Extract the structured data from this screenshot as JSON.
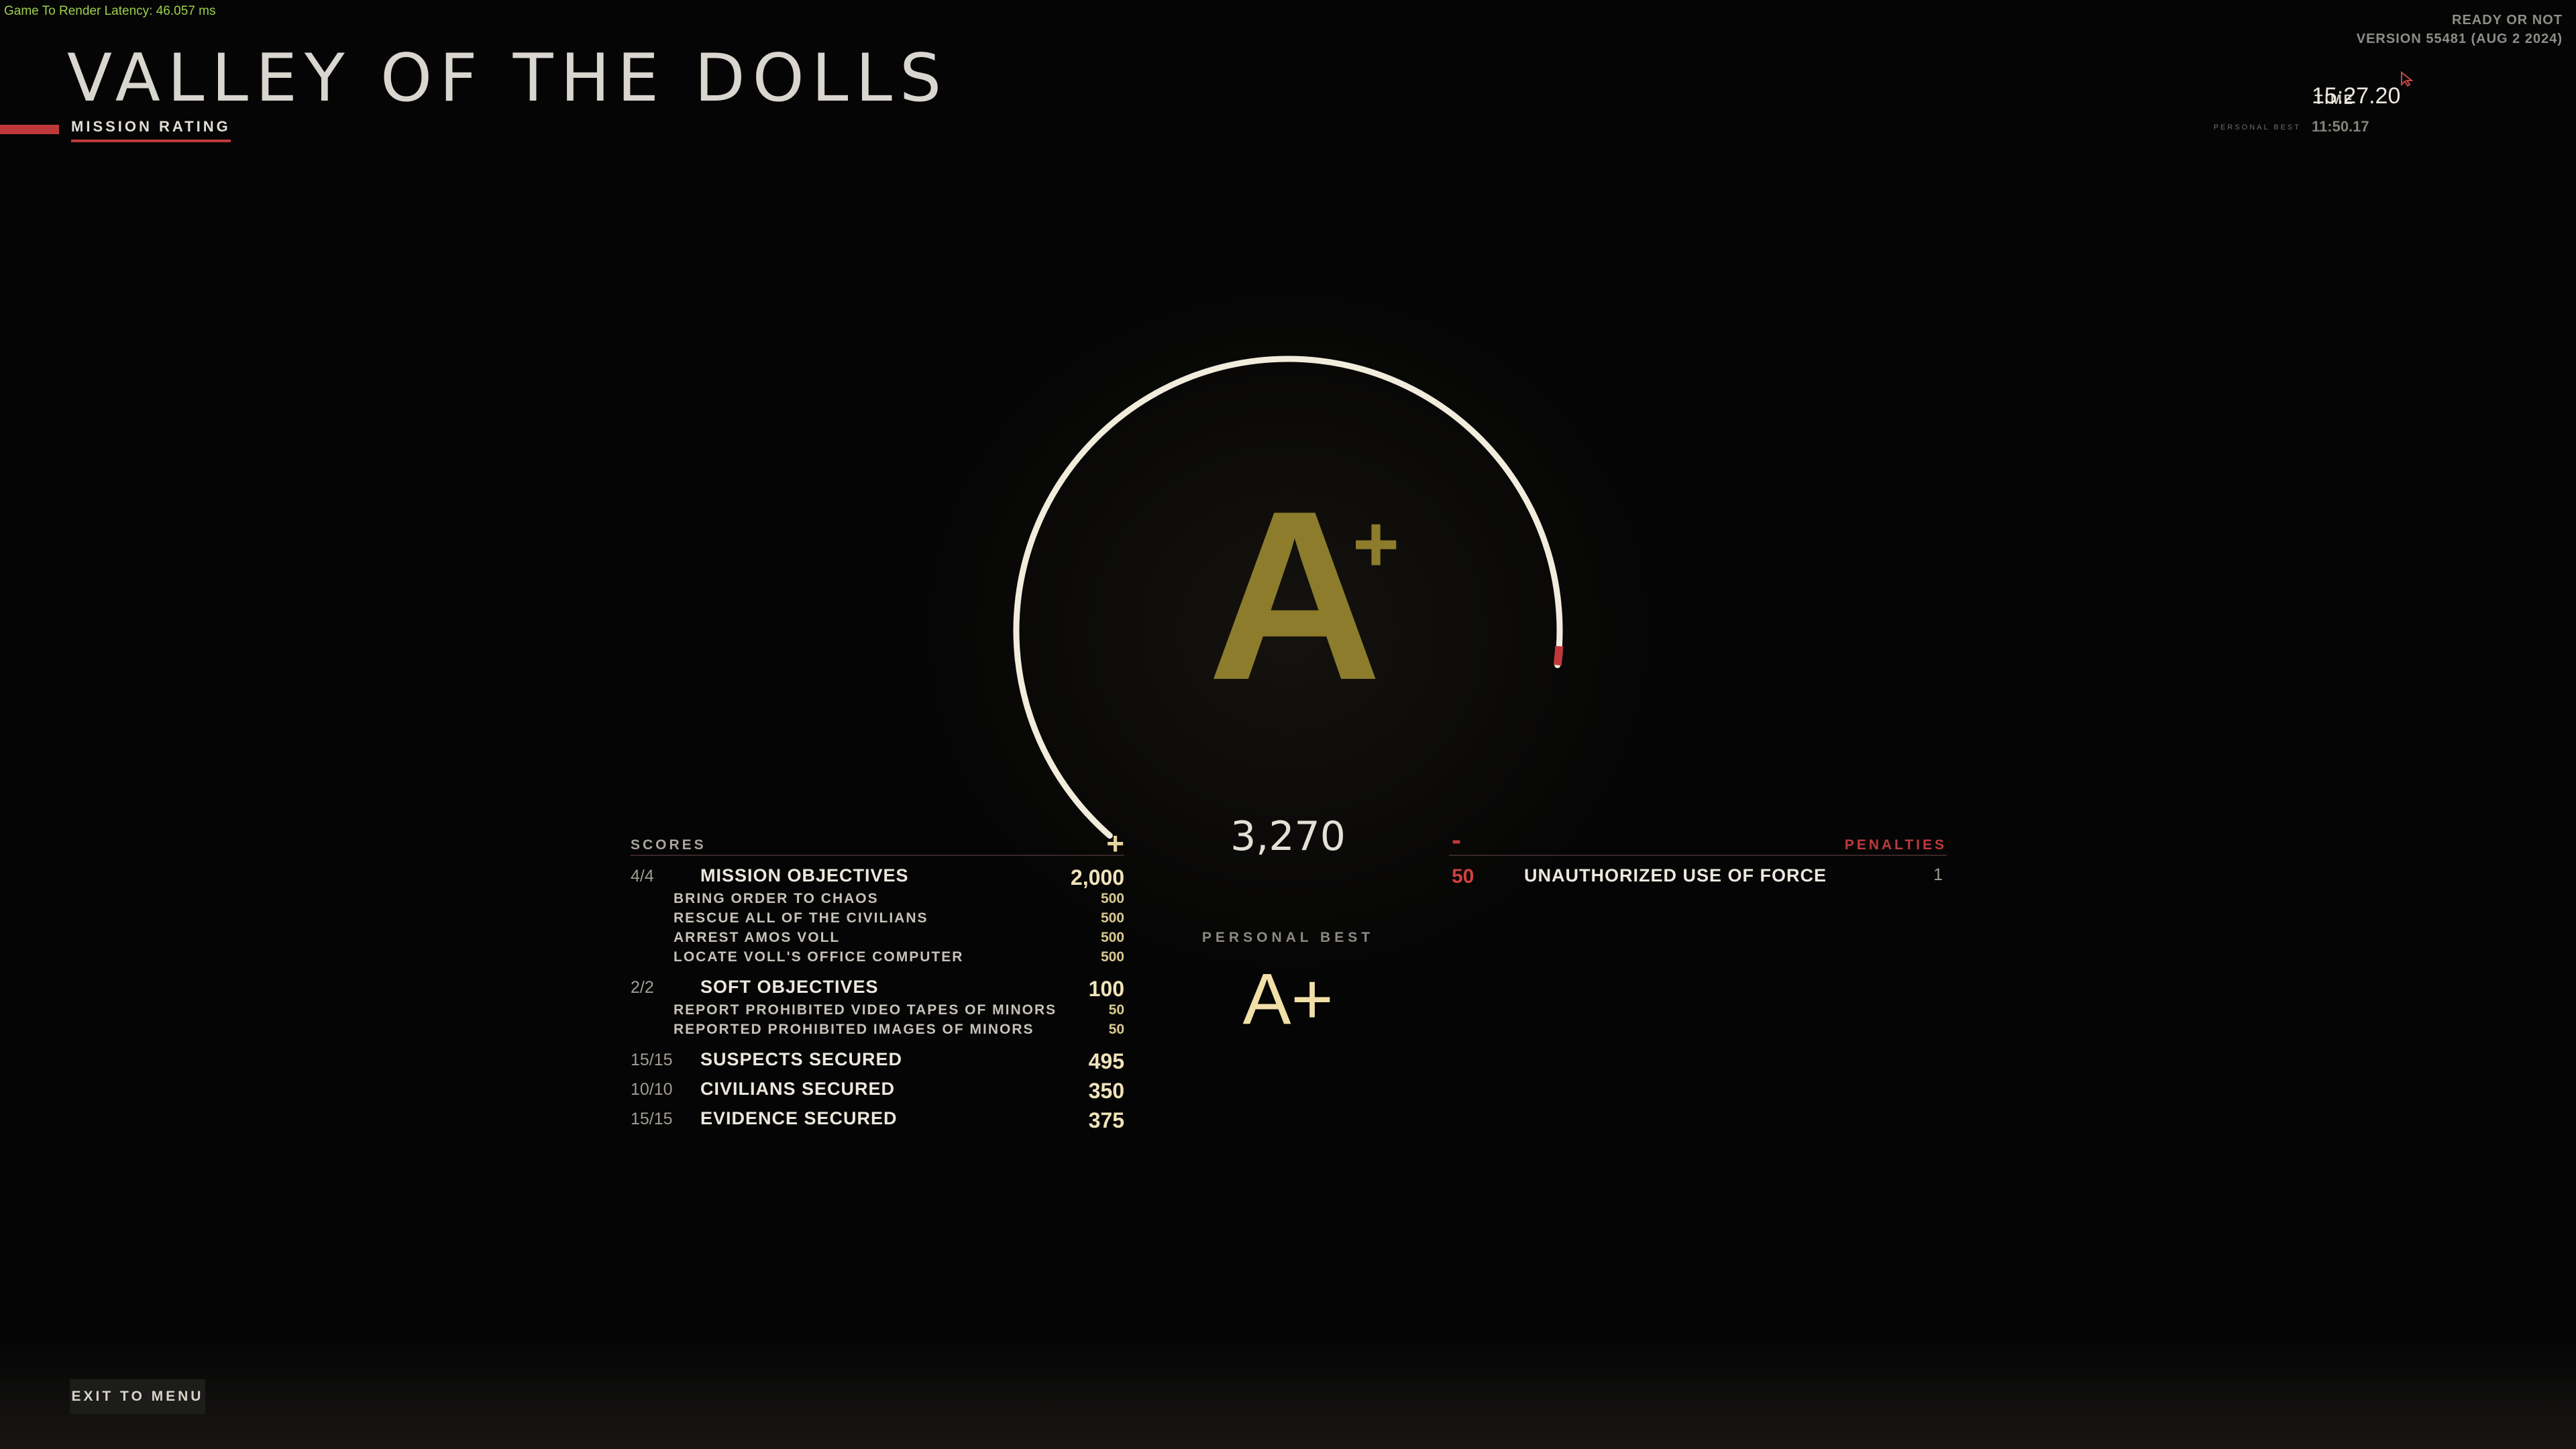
{
  "overlay": {
    "latency": "Game To Render Latency: 46.057 ms"
  },
  "build": {
    "game": "READY OR NOT",
    "version": "VERSION 55481 (AUG 2 2024)"
  },
  "mission": {
    "title": "VALLEY OF THE DOLLS",
    "tab": "MISSION RATING"
  },
  "time": {
    "label": "TIME",
    "value": "15:27.20",
    "pb_label": "PERSONAL BEST",
    "pb_value": "11:50.17"
  },
  "rating": {
    "grade": "A",
    "grade_modifier": "+",
    "total": "3,270",
    "personal_best_label": "PERSONAL BEST",
    "personal_best_grade": "A+",
    "dial_fill": 0.85
  },
  "scores": {
    "title": "SCORES",
    "plus": "+",
    "groups": [
      {
        "count": "4/4",
        "name": "MISSION OBJECTIVES",
        "points": "2,000",
        "items": [
          {
            "name": "BRING ORDER TO CHAOS",
            "points": "500"
          },
          {
            "name": "RESCUE ALL OF THE CIVILIANS",
            "points": "500"
          },
          {
            "name": "ARREST AMOS VOLL",
            "points": "500"
          },
          {
            "name": "LOCATE VOLL'S OFFICE COMPUTER",
            "points": "500"
          }
        ]
      },
      {
        "count": "2/2",
        "name": "SOFT OBJECTIVES",
        "points": "100",
        "items": [
          {
            "name": "REPORT PROHIBITED VIDEO TAPES OF MINORS",
            "points": "50"
          },
          {
            "name": "REPORTED PROHIBITED IMAGES OF MINORS",
            "points": "50"
          }
        ]
      },
      {
        "count": "15/15",
        "name": "SUSPECTS SECURED",
        "points": "495",
        "items": []
      },
      {
        "count": "10/10",
        "name": "CIVILIANS SECURED",
        "points": "350",
        "items": []
      },
      {
        "count": "15/15",
        "name": "EVIDENCE SECURED",
        "points": "375",
        "items": []
      }
    ]
  },
  "penalties": {
    "title": "PENALTIES",
    "minus": "-",
    "items": [
      {
        "points": "50",
        "name": "UNAUTHORIZED USE OF FORCE",
        "count": "1"
      }
    ]
  },
  "buttons": {
    "exit": "EXIT TO MENU"
  },
  "colors": {
    "accent_red": "#c0393a",
    "grade_gold": "#8c7c2c",
    "pb_gold": "#f1dfa8",
    "dial_white": "#f2ecdc"
  }
}
